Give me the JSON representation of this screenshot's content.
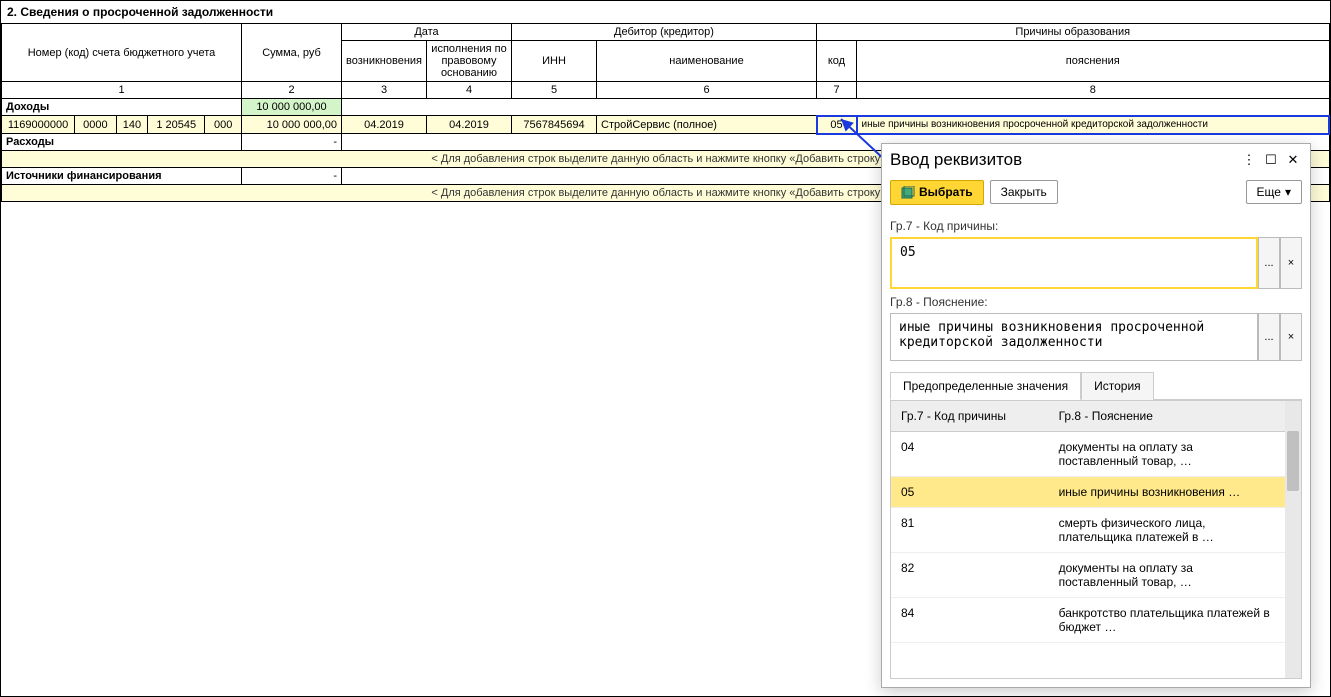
{
  "section_title": "2. Сведения о просроченной задолженности",
  "headers": {
    "acct": "Номер (код) счета бюджетного учета",
    "sum": "Сумма, руб",
    "date_group": "Дата",
    "date_origin": "возникновения",
    "date_exec": "исполнения по правовому основанию",
    "debtor_group": "Дебитор (кредитор)",
    "inn": "ИНН",
    "name": "наименование",
    "reason_group": "Причины образования",
    "code": "код",
    "explain": "пояснения",
    "n1": "1",
    "n2": "2",
    "n3": "3",
    "n4": "4",
    "n5": "5",
    "n6": "6",
    "n7": "7",
    "n8": "8"
  },
  "rows": {
    "income_label": "Доходы",
    "income_total": "10 000 000,00",
    "expense_label": "Расходы",
    "expense_total": "-",
    "sources_label": "Источники финансирования",
    "sources_total": "-",
    "help_text": "< Для добавления строк выделите данную область и нажмите кнопку «Добавить строку». >"
  },
  "data": {
    "acct1": "1169000000",
    "acct2": "0000",
    "acct3": "140",
    "acct4": "1 20545",
    "acct5": "000",
    "sum": "10 000 000,00",
    "date1": "04.2019",
    "date2": "04.2019",
    "inn": "7567845694",
    "debtor": "СтройСервис (полное)",
    "code": "05",
    "explain": "иные причины возникновения просроченной кредиторской задолженности"
  },
  "dialog": {
    "title": "Ввод реквизитов",
    "select_btn": "Выбрать",
    "close_btn": "Закрыть",
    "more_btn": "Еще",
    "field1_label": "Гр.7 - Код причины:",
    "field1_value": "05",
    "field2_label": "Гр.8 - Пояснение:",
    "field2_value": "иные причины возникновения просроченной кредиторской задолженности",
    "tab1": "Предопределенные значения",
    "tab2": "История",
    "col1": "Гр.7 - Код причины",
    "col2": "Гр.8 - Пояснение",
    "items": [
      {
        "code": "04",
        "desc": "документы на оплату за поставленный товар, …"
      },
      {
        "code": "05",
        "desc": "иные причины возникновения …"
      },
      {
        "code": "81",
        "desc": "смерть физического лица, плательщика платежей в …"
      },
      {
        "code": "82",
        "desc": "документы на оплату за поставленный товар, …"
      },
      {
        "code": "84",
        "desc": "банкротство плательщика платежей в бюджет …"
      }
    ],
    "ellipsis": "...",
    "clear": "×",
    "chevron": "▾"
  }
}
